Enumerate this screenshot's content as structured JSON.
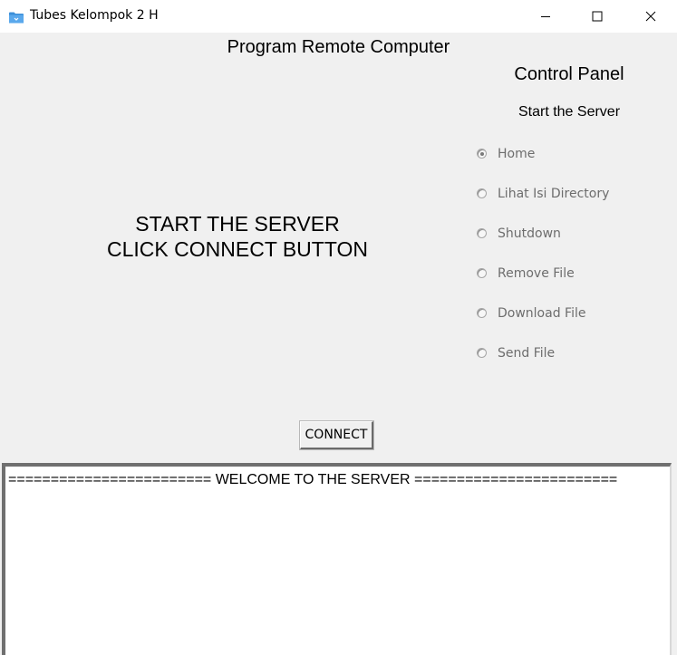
{
  "window": {
    "title": "Tubes Kelompok 2 H",
    "controls": {
      "minimize_icon": "minimize-icon",
      "maximize_icon": "maximize-icon",
      "close_icon": "close-icon"
    },
    "icon": "folder-icon",
    "accent_color": "#1e88e5"
  },
  "main": {
    "heading": "Program Remote Computer",
    "instruction_line1": "START THE SERVER",
    "instruction_line2": "CLICK CONNECT BUTTON"
  },
  "control_panel": {
    "title": "Control Panel",
    "subtitle": "Start the Server",
    "options": [
      {
        "label": "Home",
        "selected": true,
        "enabled": false
      },
      {
        "label": "Lihat Isi Directory",
        "selected": false,
        "enabled": false
      },
      {
        "label": "Shutdown",
        "selected": false,
        "enabled": false
      },
      {
        "label": "Remove File",
        "selected": false,
        "enabled": false
      },
      {
        "label": "Download File",
        "selected": false,
        "enabled": false
      },
      {
        "label": "Send File",
        "selected": false,
        "enabled": false
      }
    ]
  },
  "connect_button": {
    "label": "CONNECT"
  },
  "log": {
    "lines": [
      "======================== WELCOME TO THE SERVER ========================"
    ]
  }
}
